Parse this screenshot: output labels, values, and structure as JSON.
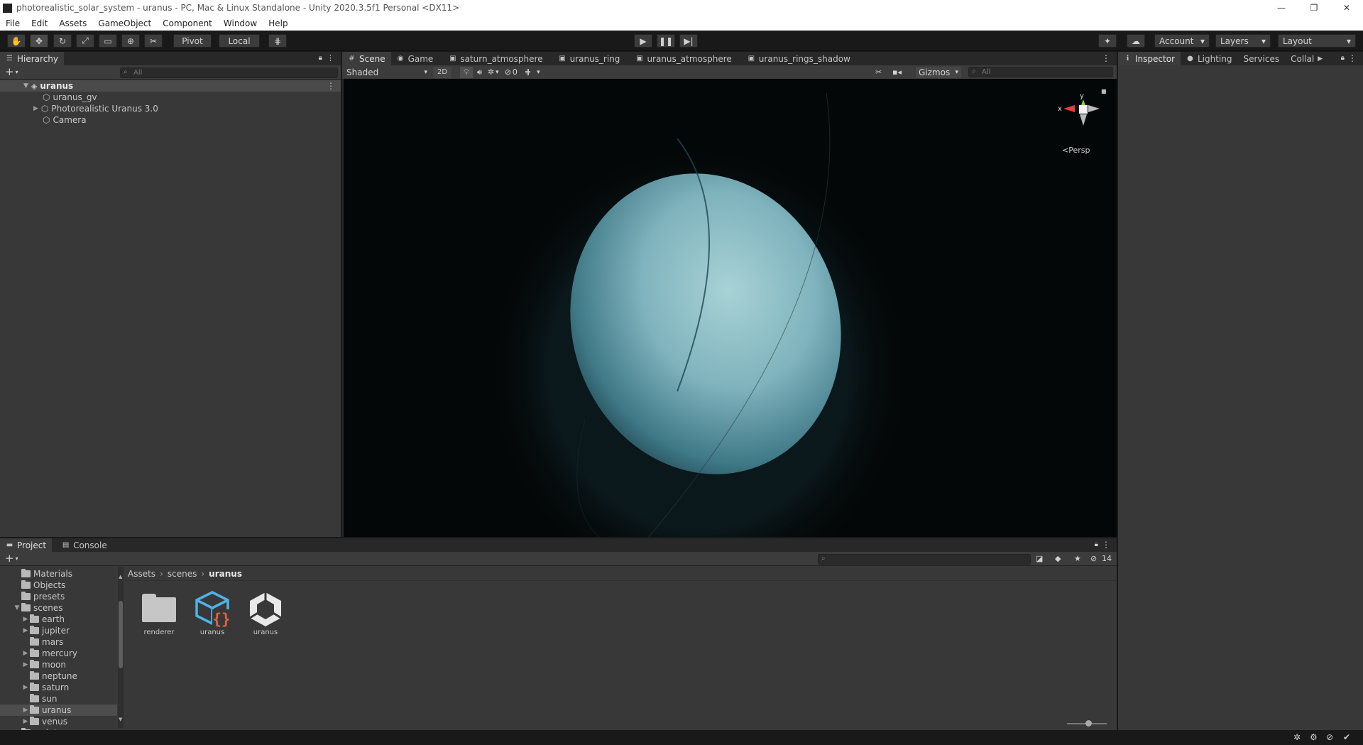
{
  "window": {
    "title": "photorealistic_solar_system - uranus - PC, Mac & Linux Standalone - Unity 2020.3.5f1 Personal <DX11>",
    "controls": [
      "—",
      "❐",
      "✕"
    ]
  },
  "menu": [
    "File",
    "Edit",
    "Assets",
    "GameObject",
    "Component",
    "Window",
    "Help"
  ],
  "toolbar": {
    "pivot": "Pivot",
    "local": "Local",
    "account": "Account",
    "layers": "Layers",
    "layout": "Layout"
  },
  "hierarchy": {
    "tab": "Hierarchy",
    "search_placeholder": "All",
    "scene_name": "uranus",
    "items": [
      "uranus_gv",
      "Photorealistic Uranus 3.0",
      "Camera"
    ]
  },
  "scene": {
    "tabs": [
      "Scene",
      "Game",
      "saturn_atmosphere",
      "uranus_ring",
      "uranus_atmosphere",
      "uranus_rings_shadow"
    ],
    "draw_mode": "Shaded",
    "mode_2d": "2D",
    "hidden_count": "0",
    "gizmos": "Gizmos",
    "search_placeholder": "All",
    "projection": "Persp",
    "axis_y": "y",
    "axis_x": "x"
  },
  "inspector": {
    "tabs": [
      "Inspector",
      "Lighting",
      "Services",
      "Collal"
    ]
  },
  "project": {
    "tabs": [
      "Project",
      "Console"
    ],
    "hidden_count": "14",
    "tree": [
      {
        "label": "Materials",
        "arrow": false,
        "indent": 0
      },
      {
        "label": "Objects",
        "arrow": false,
        "indent": 0
      },
      {
        "label": "presets",
        "arrow": false,
        "indent": 0
      },
      {
        "label": "scenes",
        "arrow": true,
        "expanded": true,
        "indent": 0
      },
      {
        "label": "earth",
        "arrow": true,
        "indent": 1
      },
      {
        "label": "jupiter",
        "arrow": true,
        "indent": 1
      },
      {
        "label": "mars",
        "arrow": false,
        "indent": 1
      },
      {
        "label": "mercury",
        "arrow": true,
        "indent": 1
      },
      {
        "label": "moon",
        "arrow": true,
        "indent": 1
      },
      {
        "label": "neptune",
        "arrow": false,
        "indent": 1
      },
      {
        "label": "saturn",
        "arrow": true,
        "indent": 1
      },
      {
        "label": "sun",
        "arrow": false,
        "indent": 1
      },
      {
        "label": "uranus",
        "arrow": true,
        "indent": 1,
        "selected": true
      },
      {
        "label": "venus",
        "arrow": true,
        "indent": 1
      },
      {
        "label": "scripts",
        "arrow": true,
        "indent": 0
      }
    ],
    "breadcrumb": [
      "Assets",
      "scenes",
      "uranus"
    ],
    "assets": [
      {
        "label": "renderer",
        "icon": "folder-icon"
      },
      {
        "label": "uranus",
        "icon": "prefab-script-icon"
      },
      {
        "label": "uranus",
        "icon": "unity-scene-icon"
      }
    ]
  },
  "colors": {
    "panel": "#383838",
    "dark": "#191919",
    "selection": "#4d4d4d",
    "planet": "#7fb3bd"
  }
}
